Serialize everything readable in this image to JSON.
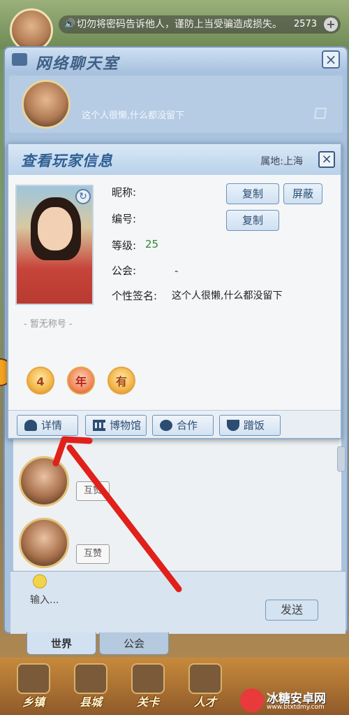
{
  "top_bar": {
    "notice": "切勿将密码告诉他人，谨防上当受骗造成损失。",
    "coin_count": "2573"
  },
  "chat_room": {
    "title": "网络聊天室",
    "self_signature": "这个人很懒,什么都没留下",
    "like_label": "互赞",
    "input_placeholder": "输入...",
    "send_label": "发送",
    "tabs": [
      {
        "label": "世界",
        "active": true
      },
      {
        "label": "公会",
        "active": false
      }
    ]
  },
  "player_info": {
    "title": "查看玩家信息",
    "region": "属地:上海",
    "no_title": "- 暂无称号 -",
    "fields": {
      "nickname_label": "昵称:",
      "id_label": "编号:",
      "level_label": "等级:",
      "level_value": "25",
      "guild_label": "公会:",
      "guild_value": "-",
      "signature_label": "个性签名:",
      "signature_value": "这个人很懒,什么都没留下"
    },
    "buttons": {
      "copy": "复制",
      "block": "屏蔽"
    },
    "badges": [
      "4",
      "年",
      "有"
    ],
    "actions": [
      {
        "label": "详情",
        "icon": "person-icon"
      },
      {
        "label": "博物馆",
        "icon": "museum-icon"
      },
      {
        "label": "合作",
        "icon": "film-reel-icon"
      },
      {
        "label": "蹭饭",
        "icon": "bowl-icon"
      }
    ]
  },
  "bottom_nav": [
    {
      "label": "乡镇"
    },
    {
      "label": "县城"
    },
    {
      "label": "关卡"
    },
    {
      "label": "人才"
    }
  ],
  "watermark": {
    "title": "冰糖安卓网",
    "url": "www.btxtdmy.com"
  },
  "colors": {
    "annotation_arrow": "#e0201a",
    "level_green": "#2f8a2f",
    "dialog_title_blue": "#2f5f93"
  }
}
